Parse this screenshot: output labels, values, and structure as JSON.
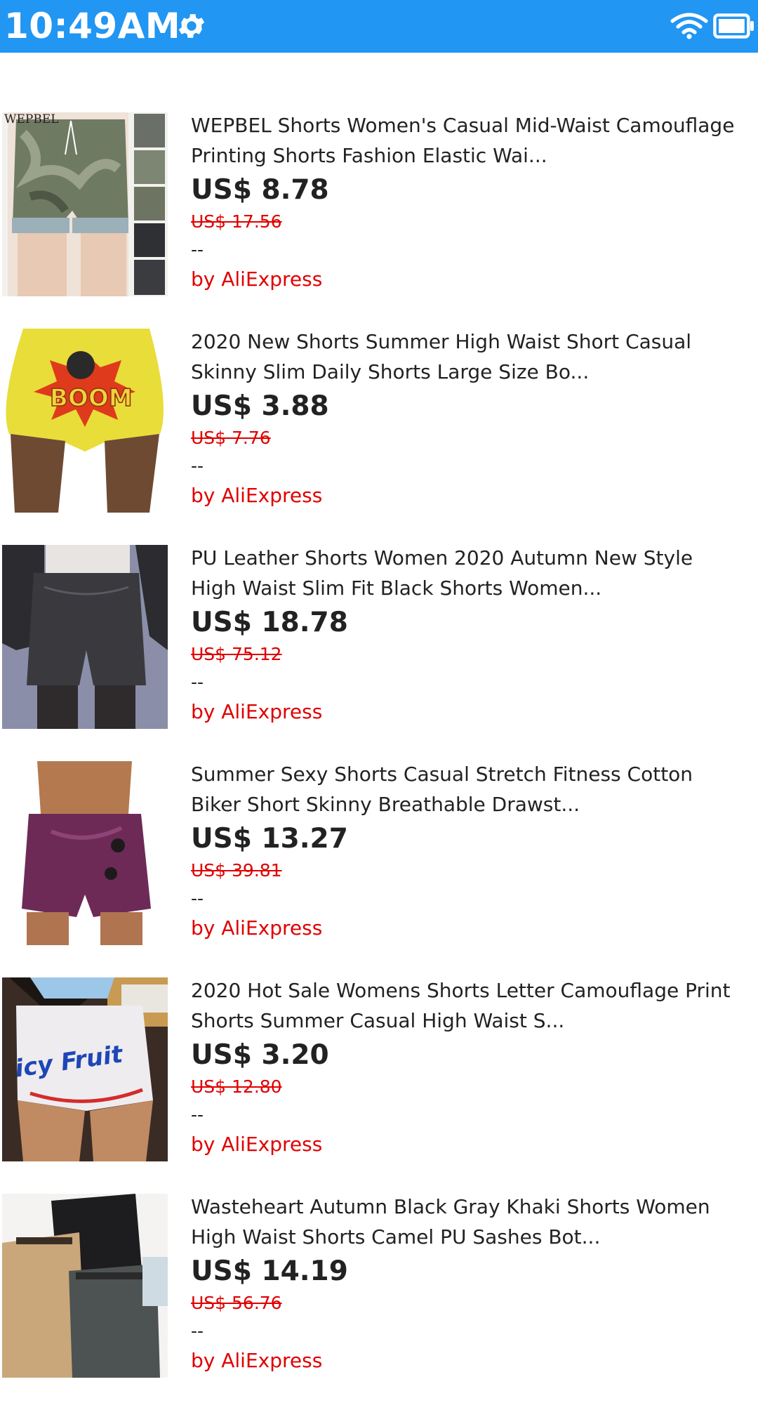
{
  "status_bar": {
    "time": "10:49AM",
    "bg_color": "#2196f3",
    "icons": [
      "gear-icon",
      "wifi-icon",
      "battery-icon"
    ]
  },
  "accent_colors": {
    "price_red": "#e00000",
    "text_dark": "#222222"
  },
  "products": [
    {
      "title_line1": "WEPBEL Shorts Women's Casual Mid-Waist Camouflage",
      "title_line2": "Printing Shorts Fashion Elastic Wai...",
      "price": "US$ 8.78",
      "original_price": "US$ 17.56",
      "rating": "--",
      "seller": "by AliExpress",
      "image_label": "WEPBEL"
    },
    {
      "title_line1": "2020 New Shorts Summer High Waist Short Casual",
      "title_line2": "Skinny Slim Daily Shorts Large Size Bo...",
      "price": "US$ 3.88",
      "original_price": "US$ 7.76",
      "rating": "--",
      "seller": "by AliExpress",
      "image_label": "BOOM"
    },
    {
      "title_line1": "PU Leather Shorts Women 2020 Autumn New Style",
      "title_line2": "High Waist Slim Fit Black Shorts Women...",
      "price": "US$ 18.78",
      "original_price": "US$ 75.12",
      "rating": "--",
      "seller": "by AliExpress"
    },
    {
      "title_line1": "Summer Sexy Shorts Casual Stretch Fitness Cotton",
      "title_line2": "Biker Short Skinny Breathable Drawst...",
      "price": "US$ 13.27",
      "original_price": "US$ 39.81",
      "rating": "--",
      "seller": "by AliExpress"
    },
    {
      "title_line1": "2020 Hot Sale Womens Shorts Letter Camouflage Print",
      "title_line2": "Shorts Summer Casual High Waist S...",
      "price": "US$ 3.20",
      "original_price": "US$ 12.80",
      "rating": "--",
      "seller": "by AliExpress",
      "image_label": "icy Fruit"
    },
    {
      "title_line1": "Wasteheart Autumn Black Gray Khaki Shorts Women",
      "title_line2": "High Waist Shorts Camel PU Sashes Bot...",
      "price": "US$ 14.19",
      "original_price": "US$ 56.76",
      "rating": "--",
      "seller": "by AliExpress"
    }
  ]
}
